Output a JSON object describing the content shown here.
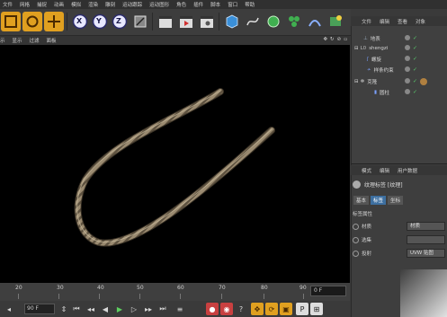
{
  "menubar": {
    "items": [
      "文件",
      "网格",
      "捕捉",
      "动画",
      "模拟",
      "渲染",
      "雕刻",
      "运动跟踪",
      "运动图形",
      "角色",
      "插件",
      "脚本",
      "窗口",
      "帮助"
    ]
  },
  "viewport_menu": {
    "items": [
      "示",
      "显示",
      "过滤",
      "面板"
    ],
    "icons": [
      "move-icon",
      "rotate-icon",
      "maximize-icon",
      "layout-icon"
    ]
  },
  "toolbar": {
    "axis_x": "X",
    "axis_y": "Y",
    "axis_z": "Z"
  },
  "object_manager": {
    "tabs": [
      "文件",
      "编辑",
      "查看",
      "对象"
    ],
    "objects": [
      {
        "label": "地表",
        "indent": 0
      },
      {
        "label": "shengzi",
        "indent": 0
      },
      {
        "label": "螺旋",
        "indent": 1
      },
      {
        "label": "样条约束",
        "indent": 1
      },
      {
        "label": "克隆",
        "indent": 0
      },
      {
        "label": "圆柱",
        "indent": 1
      }
    ]
  },
  "attributes": {
    "tabs": [
      "模式",
      "编辑",
      "用户数据"
    ],
    "title": "纹理标签 [纹理]",
    "subtabs": [
      "基本",
      "标签",
      "坐标"
    ],
    "active_subtab": "标签",
    "section": "标签属性",
    "props": [
      {
        "label": "材质",
        "value": "材质"
      },
      {
        "label": "选集",
        "value": ""
      },
      {
        "label": "投射",
        "value": "UVW 贴图"
      }
    ]
  },
  "timeline": {
    "ticks": [
      "20",
      "30",
      "40",
      "50",
      "60",
      "70",
      "80",
      "90"
    ],
    "frame_display": "0 F",
    "current_frame": "90 F"
  },
  "colors": {
    "accent_blue": "#3d6fa0",
    "rope": "#9a8a70",
    "viewport_bg": "#000000"
  }
}
